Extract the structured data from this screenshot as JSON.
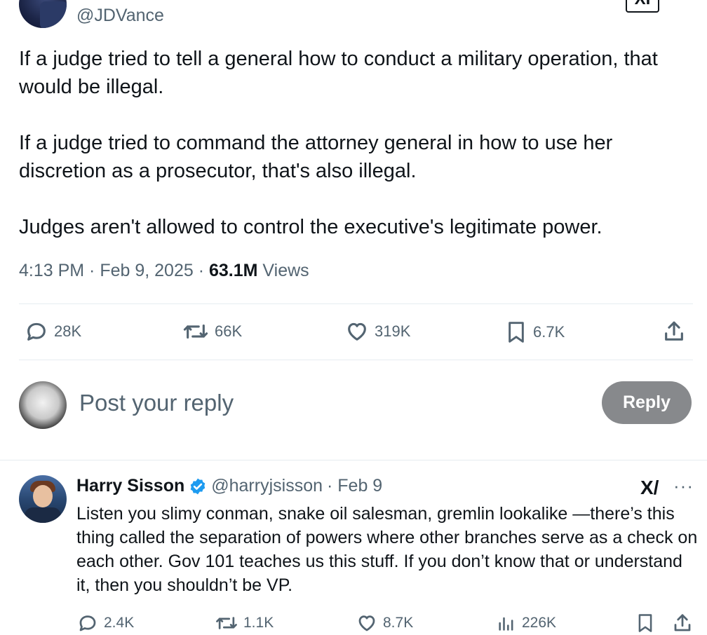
{
  "tweet": {
    "handle": "@JDVance",
    "paragraph1": "If a judge tried to tell a general how to conduct a military operation, that would be illegal.",
    "paragraph2": "If a judge tried to command the attorney general in how to use her discretion as a prosecutor, that's also illegal.",
    "paragraph3": "Judges aren't allowed to control the executive's legitimate power.",
    "timestamp": "4:13 PM · Feb 9, 2025 · ",
    "views_count": "63.1M",
    "views_label": " Views",
    "grok_label": "XI",
    "stats": {
      "replies": "28K",
      "reposts": "66K",
      "likes": "319K",
      "bookmarks": "6.7K"
    }
  },
  "composer": {
    "placeholder": "Post your reply",
    "reply_button": "Reply"
  },
  "reply": {
    "name": "Harry Sisson",
    "handle": "@harryjsisson",
    "date": "· Feb 9",
    "text": "Listen you slimy conman, snake oil salesman, gremlin lookalike —there’s this thing called the separation of powers where other branches serve as a check on each other. Gov 101 teaches us this stuff. If you don’t know that or understand it, then you shouldn’t be VP.",
    "more_glyph": "···",
    "grok_glyph": "X/",
    "stats": {
      "replies": "2.4K",
      "reposts": "1.1K",
      "likes": "8.7K",
      "views": "226K"
    }
  },
  "colors": {
    "text_primary": "#0f1419",
    "text_secondary": "#536471",
    "verified_blue": "#1d9bf0",
    "reply_button_bg": "#87898c",
    "divider": "#e6ecf0"
  },
  "icons": [
    "reply-icon",
    "repost-icon",
    "like-icon",
    "bookmark-icon",
    "share-icon",
    "views-icon",
    "verified-badge-icon",
    "more-icon",
    "grok-icon"
  ]
}
